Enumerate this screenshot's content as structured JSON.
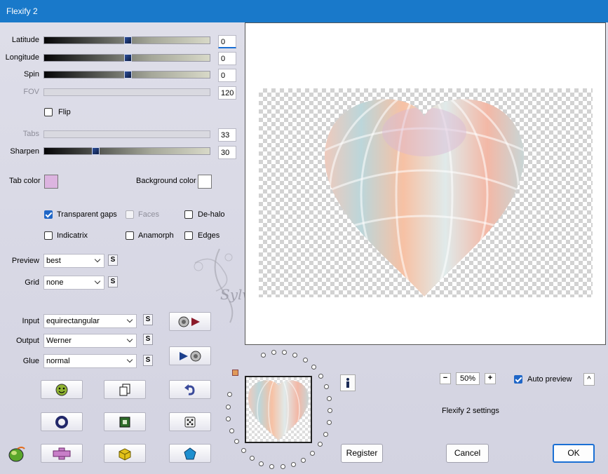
{
  "window": {
    "title": "Flexify 2"
  },
  "sliders": [
    {
      "id": "latitude",
      "label": "Latitude",
      "value": "0",
      "enabled": true,
      "level": 0.5
    },
    {
      "id": "longitude",
      "label": "Longitude",
      "value": "0",
      "enabled": true,
      "level": 0.5
    },
    {
      "id": "spin",
      "label": "Spin",
      "value": "0",
      "enabled": true,
      "level": 0.5
    },
    {
      "id": "fov",
      "label": "FOV",
      "value": "120",
      "enabled": false
    },
    {
      "id": "tabs",
      "label": "Tabs",
      "value": "33",
      "enabled": false
    },
    {
      "id": "sharpen",
      "label": "Sharpen",
      "value": "30",
      "enabled": true,
      "level": 0.3
    }
  ],
  "flip": {
    "label": "Flip",
    "checked": false
  },
  "colors": {
    "tab_label": "Tab color",
    "tab_color": "#dcb4e0",
    "background_label": "Background color",
    "background_color": "#ffffff",
    "accent": "#1979ca"
  },
  "options": {
    "transparent_gaps": {
      "label": "Transparent gaps",
      "checked": true
    },
    "faces": {
      "label": "Faces",
      "checked": false,
      "enabled": false
    },
    "de_halo": {
      "label": "De-halo",
      "checked": false
    },
    "indicatrix": {
      "label": "Indicatrix",
      "checked": false
    },
    "anamorph": {
      "label": "Anamorph",
      "checked": false
    },
    "edges": {
      "label": "Edges",
      "checked": false
    }
  },
  "preview_mode": {
    "label": "Preview",
    "value": "best"
  },
  "grid": {
    "label": "Grid",
    "value": "none"
  },
  "input": {
    "label": "Input",
    "value": "equirectangular"
  },
  "output": {
    "label": "Output",
    "value": "Werner"
  },
  "glue": {
    "label": "Glue",
    "value": "normal"
  },
  "s_button_label": "S",
  "icons": {
    "input_swap": "globe-to-arrow-icon",
    "output_swap": "arrow-to-globe-icon",
    "row1": [
      "smiley-globe-icon",
      "copy-pages-icon",
      "undo-icon"
    ],
    "row2": [
      "ring-icon",
      "square-frame-icon",
      "dice-icon"
    ],
    "row3": [
      "cross-shape-icon",
      "cube-icon",
      "pentagon-gem-icon"
    ],
    "logo": "flexify-logo-icon",
    "info": "info-icon"
  },
  "watermark": {
    "text": "Sylviane"
  },
  "zoom": {
    "value": "50%",
    "minus": "−",
    "plus": "+"
  },
  "auto_preview": {
    "label": "Auto preview",
    "checked": true
  },
  "collapse": {
    "label": "^"
  },
  "settings_label": "Flexify 2 settings",
  "buttons": {
    "register": "Register",
    "cancel": "Cancel",
    "ok": "OK"
  }
}
